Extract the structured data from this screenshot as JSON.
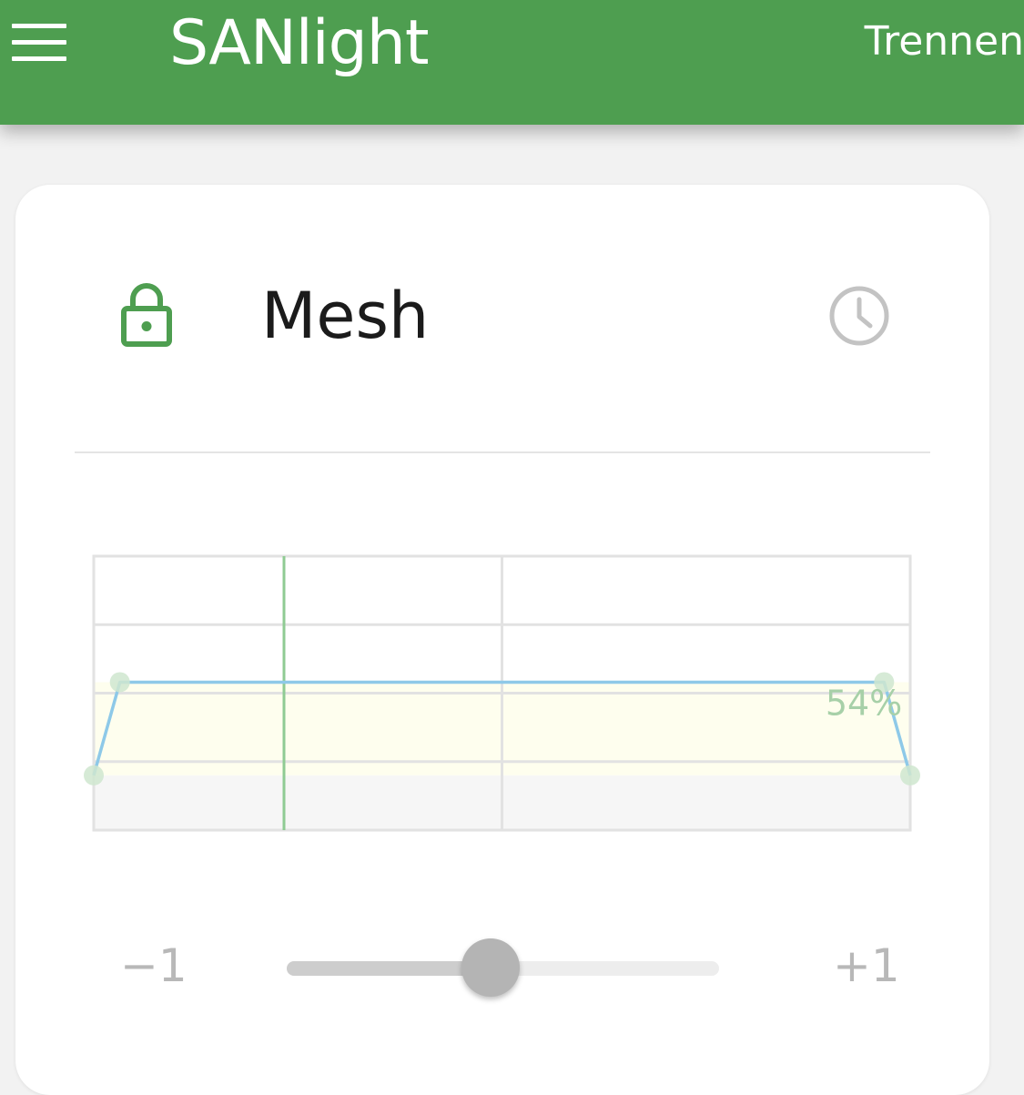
{
  "appbar": {
    "title": "SANlight",
    "action_label": "Trennen",
    "menu_icon": "hamburger-menu-icon",
    "color": "#4e9e50"
  },
  "card": {
    "group_name": "Mesh",
    "lock_icon": "lock-icon",
    "lock_color": "#4e9e50",
    "schedule_icon": "clock-icon"
  },
  "chart_data": {
    "type": "line",
    "title": "",
    "xlabel": "",
    "ylabel": "",
    "ylim": [
      0,
      100
    ],
    "xlim": [
      0,
      1
    ],
    "grid": true,
    "series": [
      {
        "color": "#8ec9e8",
        "x": [
          0.0,
          0.032,
          0.968,
          1.0
        ],
        "y": [
          20,
          54,
          54,
          20
        ]
      }
    ],
    "point_color": "#cfe6cf",
    "value_label": "54%",
    "current_time_marker": 0.233,
    "marker_color": "#8fcb93",
    "band_color": "#fefeee",
    "floor_color": "#f6f6f6"
  },
  "slider": {
    "min_label": "−1",
    "max_label": "+1",
    "value": 0.43
  }
}
